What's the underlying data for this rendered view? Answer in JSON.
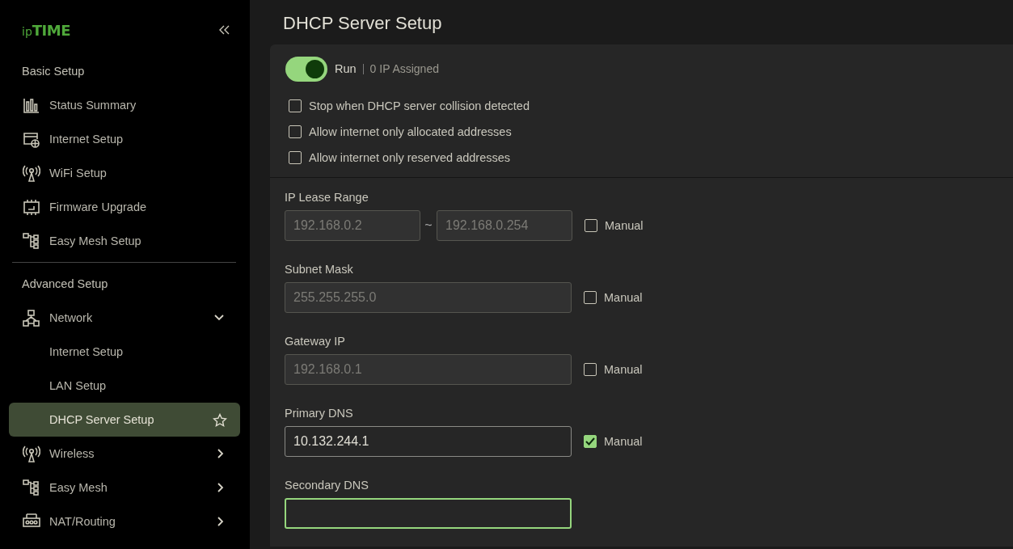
{
  "sidebar": {
    "logo": {
      "prefix": "ip",
      "main": "TIME"
    },
    "sections": [
      {
        "title": "Basic Setup",
        "items": [
          {
            "label": "Status Summary"
          },
          {
            "label": "Internet Setup"
          },
          {
            "label": "WiFi Setup"
          },
          {
            "label": "Firmware Upgrade"
          },
          {
            "label": "Easy Mesh Setup"
          }
        ]
      },
      {
        "title": "Advanced Setup",
        "items": [
          {
            "label": "Network",
            "expanded": true,
            "children": [
              {
                "label": "Internet Setup",
                "selected": false
              },
              {
                "label": "LAN Setup",
                "selected": false
              },
              {
                "label": "DHCP Server Setup",
                "selected": true
              }
            ]
          },
          {
            "label": "Wireless",
            "expanded": false
          },
          {
            "label": "Easy Mesh",
            "expanded": false
          },
          {
            "label": "NAT/Routing",
            "expanded": false
          }
        ]
      }
    ]
  },
  "page": {
    "title": "DHCP Server Setup",
    "run": {
      "on": true,
      "label": "Run",
      "status": "0 IP Assigned"
    },
    "options": [
      {
        "label": "Stop when DHCP server collision detected",
        "checked": false
      },
      {
        "label": "Allow internet only allocated addresses",
        "checked": false
      },
      {
        "label": "Allow internet only reserved addresses",
        "checked": false
      }
    ],
    "fields": [
      {
        "label": "IP Lease Range",
        "values": [
          "192.168.0.2",
          "192.168.0.254"
        ],
        "separator": "~",
        "manual": {
          "label": "Manual",
          "checked": false
        }
      },
      {
        "label": "Subnet Mask",
        "values": [
          "255.255.255.0"
        ],
        "manual": {
          "label": "Manual",
          "checked": false
        }
      },
      {
        "label": "Gateway IP",
        "values": [
          "192.168.0.1"
        ],
        "manual": {
          "label": "Manual",
          "checked": false
        }
      },
      {
        "label": "Primary DNS",
        "values": [
          "10.132.244.1"
        ],
        "manual": {
          "label": "Manual",
          "checked": true
        }
      },
      {
        "label": "Secondary DNS",
        "focused": true
      }
    ]
  }
}
